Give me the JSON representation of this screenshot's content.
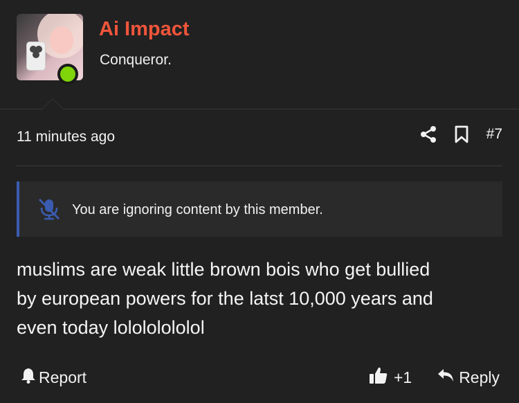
{
  "post": {
    "author": {
      "name": "Ai Impact",
      "title": "Conqueror.",
      "name_color": "#f0553b",
      "online_color": "#7fd40a",
      "avatar_icon": "avatar-photo"
    },
    "timestamp": "11 minutes ago",
    "post_number": "#7",
    "ignored_notice": "You are ignoring content by this member.",
    "message_lines": [
      "muslims are weak little brown bois who get bullied",
      "by european powers for the latst 10,000 years and",
      "even today lolololololol"
    ],
    "actions": {
      "report": "Report",
      "reaction_count": "+1",
      "reply": "Reply"
    },
    "icons": {
      "share": "share-icon",
      "bookmark": "bookmark-icon",
      "muted": "microphone-slash-icon",
      "report": "bell-icon",
      "like": "thumbs-up-icon",
      "reply": "reply-arrow-icon"
    },
    "accent_color": "#3a5bb0"
  }
}
